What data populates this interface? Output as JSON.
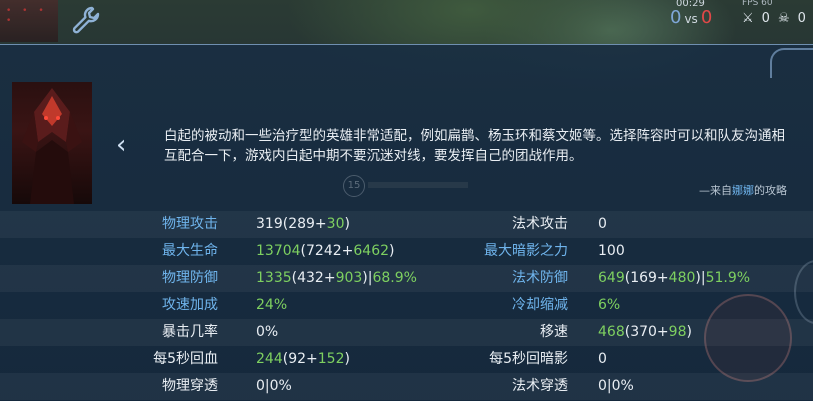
{
  "hud": {
    "time": "00:29",
    "fps": "FPS 60",
    "score_blue": "0",
    "vs": "vs",
    "score_red": "0",
    "kills": "0",
    "deaths": "0"
  },
  "hero": {
    "description": "白起的被动和一些治疗型的英雄非常适配，例如扁鹊、杨玉环和蔡文姬等。选择阵容时可以和队友沟通相互配合一下，游戏内白起中期不要沉迷对线，要发挥自己的团战作用。",
    "source_prefix": "—来自",
    "source_author": "娜娜",
    "source_suffix": "的攻略",
    "level": "15"
  },
  "stats": [
    {
      "label_l": "物理攻击",
      "label_l_color": "blue",
      "value_l": [
        [
          "319",
          "white"
        ],
        [
          "(289+",
          "white"
        ],
        [
          "30",
          "green"
        ],
        [
          ")",
          "white"
        ]
      ],
      "label_r": "法术攻击",
      "label_r_color": "white",
      "value_r": [
        [
          "0",
          "white"
        ]
      ]
    },
    {
      "label_l": "最大生命",
      "label_l_color": "blue",
      "value_l": [
        [
          "13704",
          "green"
        ],
        [
          "(7242+",
          "white"
        ],
        [
          "6462",
          "green"
        ],
        [
          ")",
          "white"
        ]
      ],
      "label_r": "最大暗影之力",
      "label_r_color": "blue",
      "value_r": [
        [
          "100",
          "white"
        ]
      ]
    },
    {
      "label_l": "物理防御",
      "label_l_color": "blue",
      "value_l": [
        [
          "1335",
          "green"
        ],
        [
          "(432+",
          "white"
        ],
        [
          "903",
          "green"
        ],
        [
          ")|",
          "white"
        ],
        [
          "68.9%",
          "green"
        ]
      ],
      "label_r": "法术防御",
      "label_r_color": "blue",
      "value_r": [
        [
          "649",
          "green"
        ],
        [
          "(169+",
          "white"
        ],
        [
          "480",
          "green"
        ],
        [
          ")|",
          "white"
        ],
        [
          "51.9%",
          "green"
        ]
      ]
    },
    {
      "label_l": "攻速加成",
      "label_l_color": "blue",
      "value_l": [
        [
          "24%",
          "green"
        ]
      ],
      "label_r": "冷却缩减",
      "label_r_color": "blue",
      "value_r": [
        [
          "6%",
          "green"
        ]
      ]
    },
    {
      "label_l": "暴击几率",
      "label_l_color": "white",
      "value_l": [
        [
          "0%",
          "white"
        ]
      ],
      "label_r": "移速",
      "label_r_color": "white",
      "value_r": [
        [
          "468",
          "green"
        ],
        [
          "(370+",
          "white"
        ],
        [
          "98",
          "green"
        ],
        [
          ")",
          "white"
        ]
      ]
    },
    {
      "label_l": "每5秒回血",
      "label_l_color": "white",
      "value_l": [
        [
          "244",
          "green"
        ],
        [
          "(92+",
          "white"
        ],
        [
          "152",
          "green"
        ],
        [
          ")",
          "white"
        ]
      ],
      "label_r": "每5秒回暗影",
      "label_r_color": "white",
      "value_r": [
        [
          "0",
          "white"
        ]
      ]
    },
    {
      "label_l": "物理穿透",
      "label_l_color": "white",
      "value_l": [
        [
          "0|0%",
          "white"
        ]
      ],
      "label_r": "法术穿透",
      "label_r_color": "white",
      "value_r": [
        [
          "0|0%",
          "white"
        ]
      ]
    }
  ],
  "colors": {
    "blue": "#6fb4ec",
    "green": "#7ed060",
    "white": "#e9eef3"
  },
  "icons": {
    "settings": "wrench-icon",
    "back": "chevron-left-icon"
  }
}
